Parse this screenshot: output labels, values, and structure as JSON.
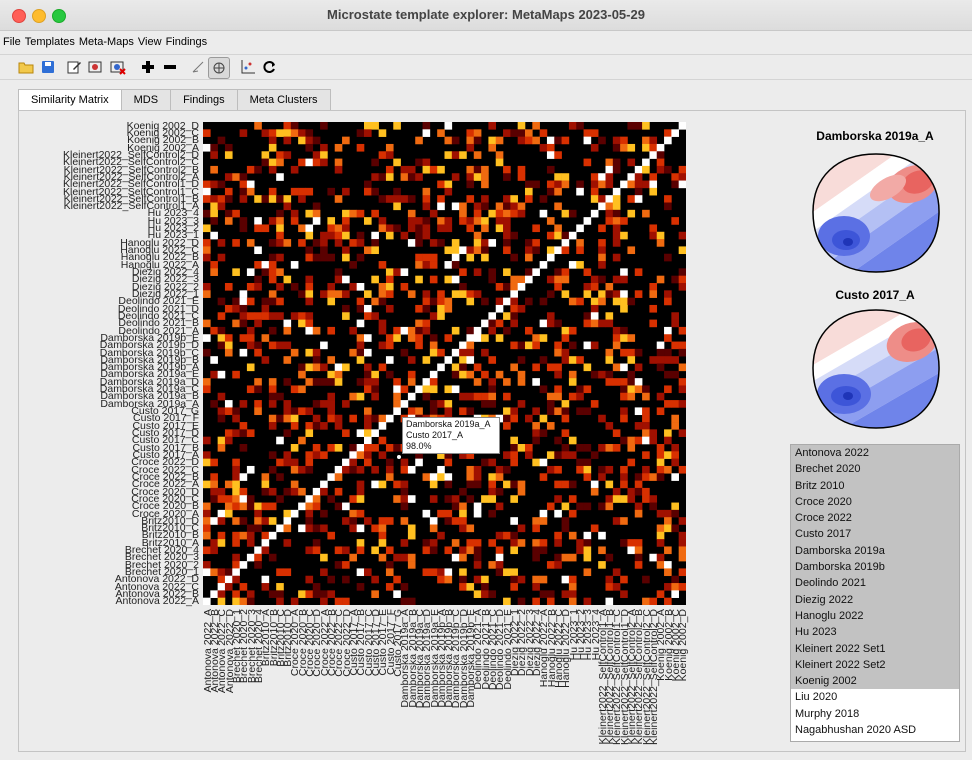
{
  "window": {
    "title": "Microstate template explorer: MetaMaps 2023-05-29"
  },
  "menu": [
    "File",
    "Templates",
    "Meta-Maps",
    "View",
    "Findings"
  ],
  "toolbar": {
    "icons": [
      "open-folder-icon",
      "save-icon",
      "edit-icon",
      "edit-map-icon",
      "delete-map-icon",
      "add-icon",
      "remove-icon",
      "select-icon",
      "3d-view-icon",
      "scatter-plot-icon",
      "refresh-icon"
    ],
    "selected": "3d-view-icon"
  },
  "tabs": [
    {
      "label": "Similarity Matrix",
      "active": true
    },
    {
      "label": "MDS",
      "active": false
    },
    {
      "label": "Findings",
      "active": false
    },
    {
      "label": "Meta Clusters",
      "active": false
    }
  ],
  "matrix": {
    "labels_bottom_to_top": [
      "Antonova 2022_A",
      "Antonova 2022_B",
      "Antonova 2022_C",
      "Antonova 2022_D",
      "Brechet 2020_1",
      "Brechet 2020_2",
      "Brechet 2020_3",
      "Brechet 2020_4",
      "Britz2010_A",
      "Britz2010_B",
      "Britz2010_C",
      "Britz2010_D",
      "Croce 2020_A",
      "Croce 2020_B",
      "Croce 2020_C",
      "Croce 2020_D",
      "Croce 2022_A",
      "Croce 2022_B",
      "Croce 2022_C",
      "Croce 2022_D",
      "Custo 2017_A",
      "Custo 2017_B",
      "Custo 2017_C",
      "Custo 2017_D",
      "Custo 2017_E",
      "Custo 2017_F",
      "Custo 2017_G",
      "Damborska 2019a_A",
      "Damborska 2019a_B",
      "Damborska 2019a_C",
      "Damborska 2019a_D",
      "Damborska 2019a_E",
      "Damborska 2019b_A",
      "Damborska 2019b_B",
      "Damborska 2019b_C",
      "Damborska 2019b_D",
      "Damborska 2019b_E",
      "Deolindo 2021_A",
      "Deolindo 2021_B",
      "Deolindo 2021_C",
      "Deolindo 2021_D",
      "Deolindo 2021_E",
      "Diezig 2022_1",
      "Diezig 2022_2",
      "Diezig 2022_3",
      "Diezig 2022_4",
      "Hanoglu 2022_A",
      "Hanoglu 2022_B",
      "Hanoglu 2022_C",
      "Hanoglu 2022_D",
      "Hu 2023_1",
      "Hu 2023_2",
      "Hu 2023_3",
      "Hu 2023_4",
      "Kleinert2022_SelfControl1_A",
      "Kleinert2022_SelfControl1_B",
      "Kleinert2022_SelfControl1_C",
      "Kleinert2022_SelfControl1_D",
      "Kleinert2022_SelfControl2_A",
      "Kleinert2022_SelfControl2_B",
      "Kleinert2022_SelfControl2_C",
      "Kleinert2022_SelfControl2_D",
      "Koenig 2002_A",
      "Koenig 2002_B",
      "Koenig 2002_C",
      "Koenig 2002_D"
    ],
    "color_scale": [
      "#000000",
      "#5a0000",
      "#a01000",
      "#d83000",
      "#f06a10",
      "#ffc020",
      "#ffffff"
    ]
  },
  "tooltip": {
    "line1": "Damborska 2019a_A",
    "line2": "Custo 2017_A",
    "line3": "98.0%"
  },
  "maps": [
    {
      "title": "Damborska 2019a_A"
    },
    {
      "title": "Custo 2017_A"
    }
  ],
  "dataset_list": [
    {
      "label": "Antonova 2022",
      "selected": true
    },
    {
      "label": "Brechet 2020",
      "selected": true
    },
    {
      "label": "Britz 2010",
      "selected": true
    },
    {
      "label": "Croce 2020",
      "selected": true
    },
    {
      "label": "Croce 2022",
      "selected": true
    },
    {
      "label": "Custo 2017",
      "selected": true
    },
    {
      "label": "Damborska 2019a",
      "selected": true
    },
    {
      "label": "Damborska 2019b",
      "selected": true
    },
    {
      "label": "Deolindo 2021",
      "selected": true
    },
    {
      "label": "Diezig 2022",
      "selected": true
    },
    {
      "label": "Hanoglu 2022",
      "selected": true
    },
    {
      "label": "Hu 2023",
      "selected": true
    },
    {
      "label": "Kleinert 2022 Set1",
      "selected": true
    },
    {
      "label": "Kleinert 2022 Set2",
      "selected": true
    },
    {
      "label": "Koenig 2002",
      "selected": true
    },
    {
      "label": "Liu 2020",
      "selected": false
    },
    {
      "label": "Murphy 2018",
      "selected": false
    },
    {
      "label": "Nagabhushan 2020 ASD",
      "selected": false
    }
  ]
}
